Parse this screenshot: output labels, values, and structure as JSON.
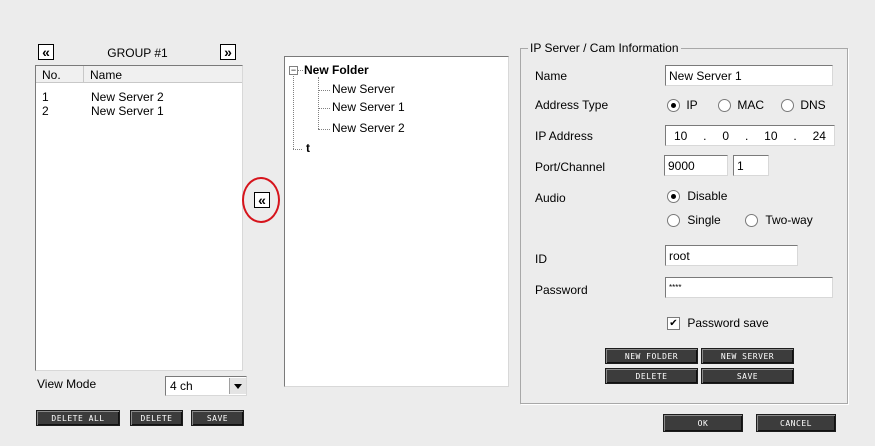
{
  "group": {
    "title": "GROUP #1",
    "prev_icon": "«",
    "next_icon": "»",
    "columns": [
      "No.",
      "Name"
    ],
    "rows": [
      {
        "no": "1",
        "name": "New Server 2"
      },
      {
        "no": "2",
        "name": "New Server 1"
      }
    ]
  },
  "view_mode": {
    "label": "View Mode",
    "value": "4 ch"
  },
  "left_buttons": {
    "delete_all": "DELETE ALL",
    "delete": "DELETE",
    "save": "SAVE"
  },
  "move_icon": "«",
  "tree": {
    "root": "New Folder",
    "children": [
      "New Server",
      "New Server 1",
      "New Server 2"
    ],
    "second_root": "t",
    "expander": "−"
  },
  "info": {
    "legend": "IP Server / Cam Information",
    "name_label": "Name",
    "name_value": "New Server 1",
    "address_type_label": "Address Type",
    "addr_opts": [
      "IP",
      "MAC",
      "DNS"
    ],
    "ip_label": "IP Address",
    "ip_octets": [
      "10",
      "0",
      "10",
      "24"
    ],
    "port_label": "Port/Channel",
    "port_value": "9000",
    "channel_value": "1",
    "audio_label": "Audio",
    "audio_opts": [
      "Disable",
      "Single",
      "Two-way"
    ],
    "id_label": "ID",
    "id_value": "root",
    "password_label": "Password",
    "password_value": "****",
    "password_save_label": "Password save",
    "new_folder": "NEW FOLDER",
    "new_server": "NEW SERVER",
    "delete": "DELETE",
    "save": "SAVE"
  },
  "dialog": {
    "ok": "OK",
    "cancel": "CANCEL"
  },
  "colors": {
    "highlight_ring": "#d6141c",
    "button_dark": "#3c3c3c"
  }
}
